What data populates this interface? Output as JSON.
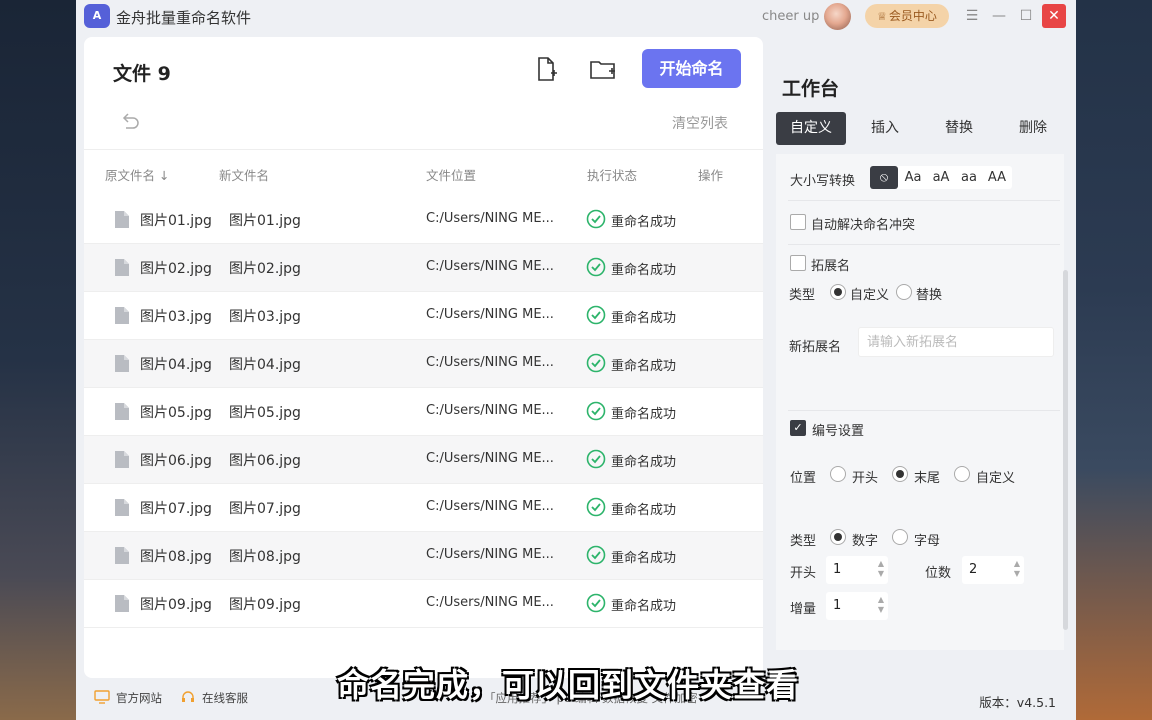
{
  "app": {
    "title": "金舟批量重命名软件",
    "logo_text": "A",
    "version": "版本：v4.5.1"
  },
  "header": {
    "username": "cheer up",
    "vip_label": "会员中心"
  },
  "files": {
    "title": "文件 9",
    "start_label": "开始命名",
    "clear_label": "清空列表",
    "columns": {
      "orig": "原文件名 ↓",
      "new": "新文件名",
      "location": "文件位置",
      "status": "执行状态",
      "action": "操作"
    },
    "rows": [
      {
        "orig": "图片01.jpg",
        "new": "图片01.jpg",
        "location": "C:/Users/NING ME...",
        "status": "重命名成功"
      },
      {
        "orig": "图片02.jpg",
        "new": "图片02.jpg",
        "location": "C:/Users/NING ME...",
        "status": "重命名成功"
      },
      {
        "orig": "图片03.jpg",
        "new": "图片03.jpg",
        "location": "C:/Users/NING ME...",
        "status": "重命名成功"
      },
      {
        "orig": "图片04.jpg",
        "new": "图片04.jpg",
        "location": "C:/Users/NING ME...",
        "status": "重命名成功"
      },
      {
        "orig": "图片05.jpg",
        "new": "图片05.jpg",
        "location": "C:/Users/NING ME...",
        "status": "重命名成功"
      },
      {
        "orig": "图片06.jpg",
        "new": "图片06.jpg",
        "location": "C:/Users/NING ME...",
        "status": "重命名成功"
      },
      {
        "orig": "图片07.jpg",
        "new": "图片07.jpg",
        "location": "C:/Users/NING ME...",
        "status": "重命名成功"
      },
      {
        "orig": "图片08.jpg",
        "new": "图片08.jpg",
        "location": "C:/Users/NING ME...",
        "status": "重命名成功"
      },
      {
        "orig": "图片09.jpg",
        "new": "图片09.jpg",
        "location": "C:/Users/NING ME...",
        "status": "重命名成功"
      }
    ]
  },
  "workbench": {
    "title": "工作台",
    "tabs": [
      "自定义",
      "插入",
      "替换",
      "删除"
    ],
    "case_label": "大小写转换",
    "case_options": [
      "Aa",
      "aA",
      "aa",
      "AA"
    ],
    "auto_resolve": "自动解决命名冲突",
    "ext_label": "拓展名",
    "type_label": "类型",
    "ext_type_options": [
      "自定义",
      "替换"
    ],
    "new_ext_label": "新拓展名",
    "new_ext_placeholder": "请输入新拓展名",
    "numbering_label": "编号设置",
    "position_label": "位置",
    "position_options": [
      "开头",
      "末尾",
      "自定义"
    ],
    "num_type_label": "类型",
    "num_type_options": [
      "数字",
      "字母"
    ],
    "start_label": "开头",
    "start_value": "1",
    "digits_label": "位数",
    "digits_value": "2",
    "increment_label": "增量",
    "increment_value": "1"
  },
  "footer": {
    "website": "官方网站",
    "service": "在线客服",
    "links": "「应用推荐」 pdf编辑 数据恢复 文件加密"
  },
  "subtitle": "命名完成，可以回到文件夹查看",
  "colors": {
    "accent": "#6b74f0",
    "dark_tab": "#3a3d44",
    "success": "#2db46b",
    "close": "#e84545"
  }
}
